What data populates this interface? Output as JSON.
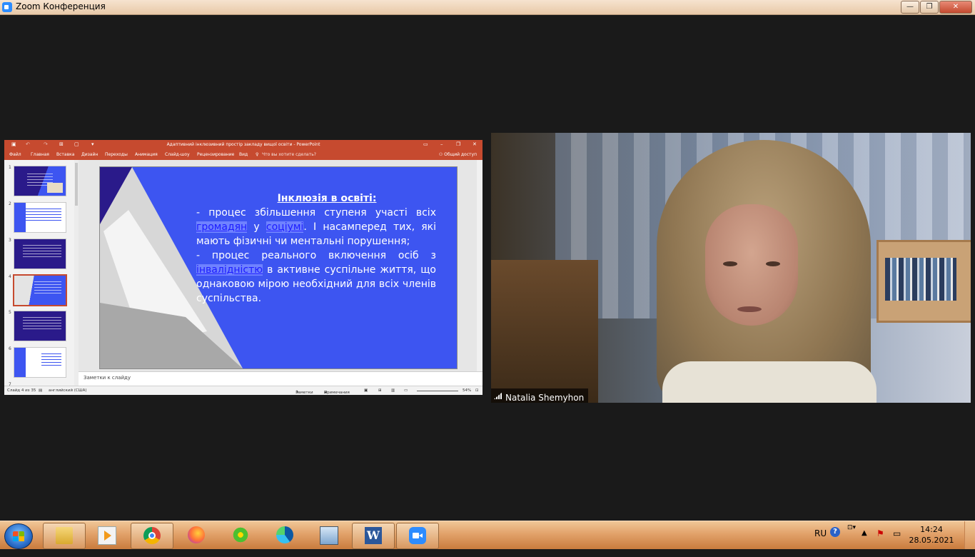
{
  "window": {
    "title": "Zoom Конференция",
    "buttons": {
      "minimize": "—",
      "maximize": "❐",
      "close": "✕"
    }
  },
  "powerpoint": {
    "title": "Адаптивний інклюзивний простір закладу вищої освіти - PowerPoint",
    "ribbon_tabs": [
      "Файл",
      "Главная",
      "Вставка",
      "Дизайн",
      "Переходы",
      "Анимация",
      "Слайд-шоу",
      "Рецензирование",
      "Вид"
    ],
    "search_placeholder": "Что вы хотите сделать?",
    "share_label": "Общий доступ",
    "thumbnail_numbers": [
      "1",
      "2",
      "3",
      "4",
      "5",
      "6",
      "7"
    ],
    "selected_slide": 4,
    "slide": {
      "heading": "Інклюзія в освіті:",
      "line1_prefix": "- процес збільшення ступеня участі всіх ",
      "link1": "громадян",
      "line1_mid": " у ",
      "link2": "соціумі",
      "line1_suffix": ". І насамперед тих, які мають фізичні чи ментальні порушення;",
      "line2_prefix": "- процес реального включення осіб з ",
      "link3": "інвалідністю",
      "line2_suffix": " в активне суспільне життя, що однаковою мірою необхідний  для всіх членів суспільства."
    },
    "notes_placeholder": "Заметки к слайду",
    "status": {
      "slide_count": "Слайд 4 из 35",
      "language": "английский (США)",
      "notes": "Заметки",
      "comments": "Примечания",
      "zoom": "54%"
    }
  },
  "participant": {
    "name": "Natalia Shemyhon"
  },
  "taskbar": {
    "apps": [
      "explorer-icon",
      "media-player-icon",
      "chrome-icon",
      "firefox-icon",
      "icq-icon",
      "edge-icon",
      "network-icon",
      "word-icon",
      "zoom-icon"
    ],
    "language": "RU",
    "time": "14:24",
    "date": "28.05.2021"
  }
}
